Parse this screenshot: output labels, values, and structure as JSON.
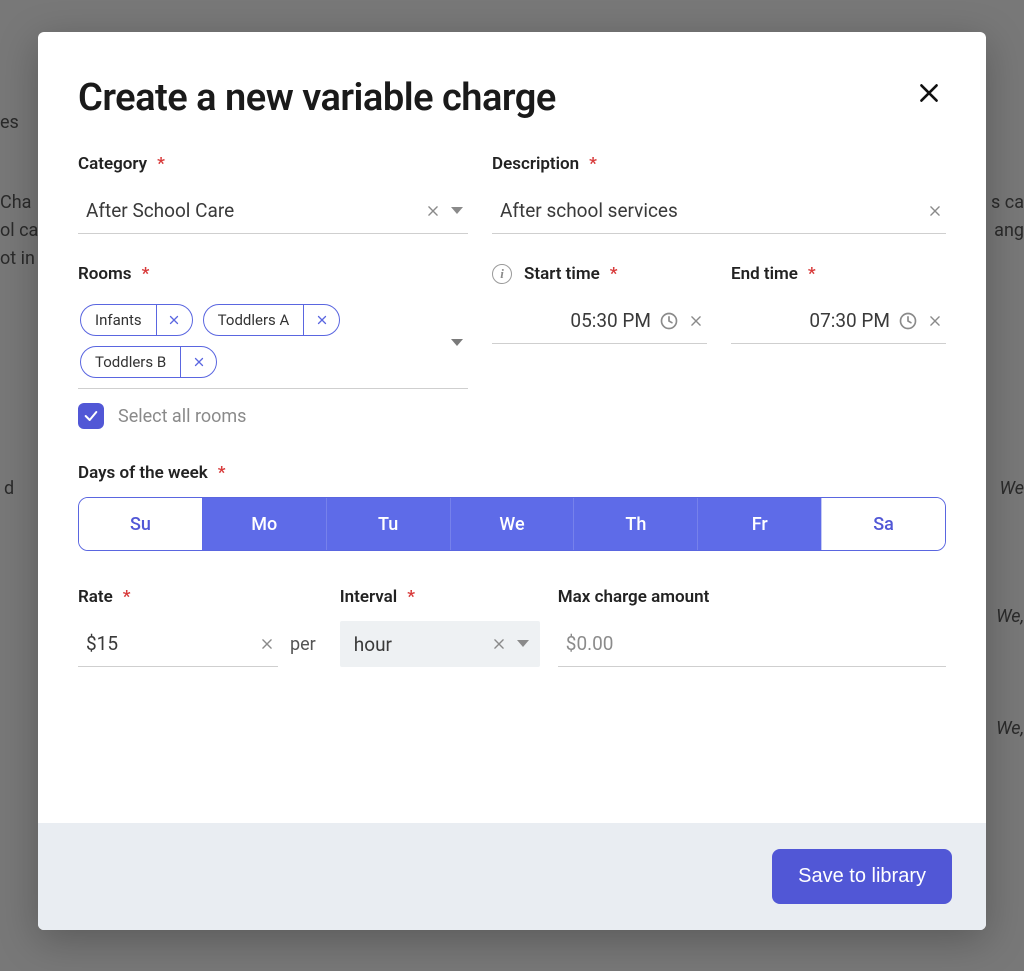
{
  "modal": {
    "title": "Create a new variable charge",
    "footer": {
      "save_label": "Save to library"
    }
  },
  "category": {
    "label": "Category",
    "value": "After School Care"
  },
  "description": {
    "label": "Description",
    "value": "After school services"
  },
  "rooms": {
    "label": "Rooms",
    "chips": [
      "Infants",
      "Toddlers A",
      "Toddlers B"
    ],
    "select_all_label": "Select all rooms",
    "select_all_checked": true
  },
  "start_time": {
    "label": "Start time",
    "value": "05:30 PM"
  },
  "end_time": {
    "label": "End time",
    "value": "07:30 PM"
  },
  "days": {
    "label": "Days of the week",
    "items": [
      {
        "abbr": "Su",
        "selected": false
      },
      {
        "abbr": "Mo",
        "selected": true
      },
      {
        "abbr": "Tu",
        "selected": true
      },
      {
        "abbr": "We",
        "selected": true
      },
      {
        "abbr": "Th",
        "selected": true
      },
      {
        "abbr": "Fr",
        "selected": true
      },
      {
        "abbr": "Sa",
        "selected": false
      }
    ]
  },
  "rate": {
    "label": "Rate",
    "value": "$15",
    "per_label": "per"
  },
  "interval": {
    "label": "Interval",
    "value": "hour"
  },
  "max_charge": {
    "label": "Max charge amount",
    "placeholder": "$0.00",
    "value": ""
  },
  "background_snippets": {
    "a": "es",
    "b": "Cha",
    "c": "ol ca",
    "d": "ot in",
    "e": "d",
    "f": "s ca",
    "g": "ang",
    "h": "We",
    "i": "We,",
    "j": "We,"
  }
}
